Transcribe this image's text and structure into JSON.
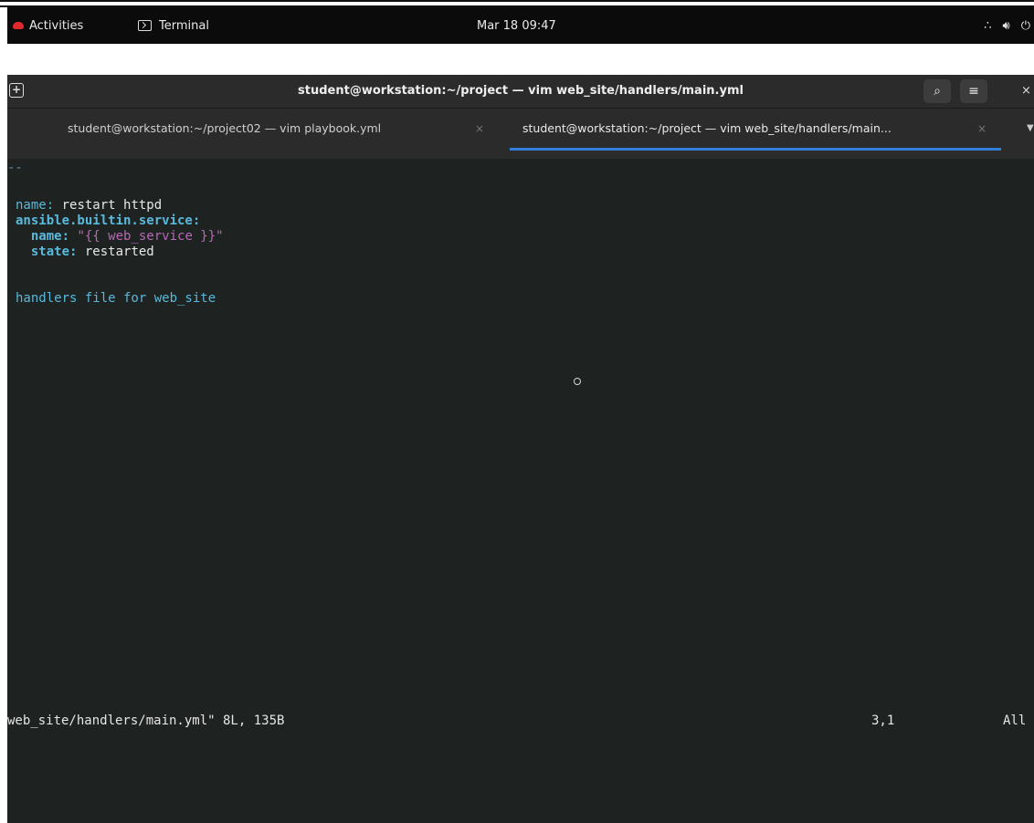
{
  "topbar": {
    "activities_label": "Activities",
    "app_label": "Terminal",
    "clock": "Mar 18 09:47",
    "icons": [
      "network-icon",
      "volume-icon",
      "power-icon"
    ]
  },
  "window": {
    "title": "student@workstation:~/project — vim web_site/handlers/main.yml",
    "icons": [
      "new-tab-icon",
      "search-icon",
      "hamburger-menu-icon",
      "close-icon"
    ]
  },
  "tabs": [
    {
      "label": "student@workstation:~/project02 — vim playbook.yml",
      "close": "×",
      "active": false
    },
    {
      "label": "student@workstation:~/project — vim web_site/handlers/main...",
      "close": "×",
      "active": true
    }
  ],
  "editor": {
    "lines": {
      "dashes": "--",
      "l1_key": "name",
      "l1_val": " restart httpd",
      "l2_key": "ansible.builtin.service",
      "l3_key": "name",
      "l3_val": "\"{{ web_service }}\"",
      "l4_key": "state",
      "l4_val": " restarted",
      "comment": "handlers file for web_site"
    },
    "status_file": "web_site/handlers/main.yml\" 8L, 135B",
    "status_pos": "3,1",
    "status_scroll": "All"
  },
  "colors": {
    "terminal_bg": "#1e2221",
    "yaml_key": "#59b9dc",
    "yaml_string": "#b868b8",
    "active_tab_underline": "#2f7ed8"
  }
}
